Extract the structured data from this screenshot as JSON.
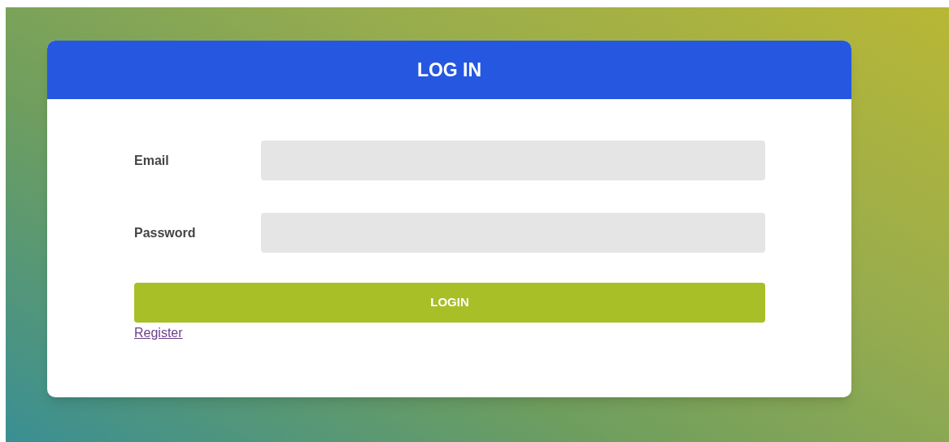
{
  "card": {
    "title": "LOG IN",
    "fields": [
      {
        "label": "Email"
      },
      {
        "label": "Password"
      }
    ],
    "submit": "LOGIN",
    "link": "Register"
  }
}
